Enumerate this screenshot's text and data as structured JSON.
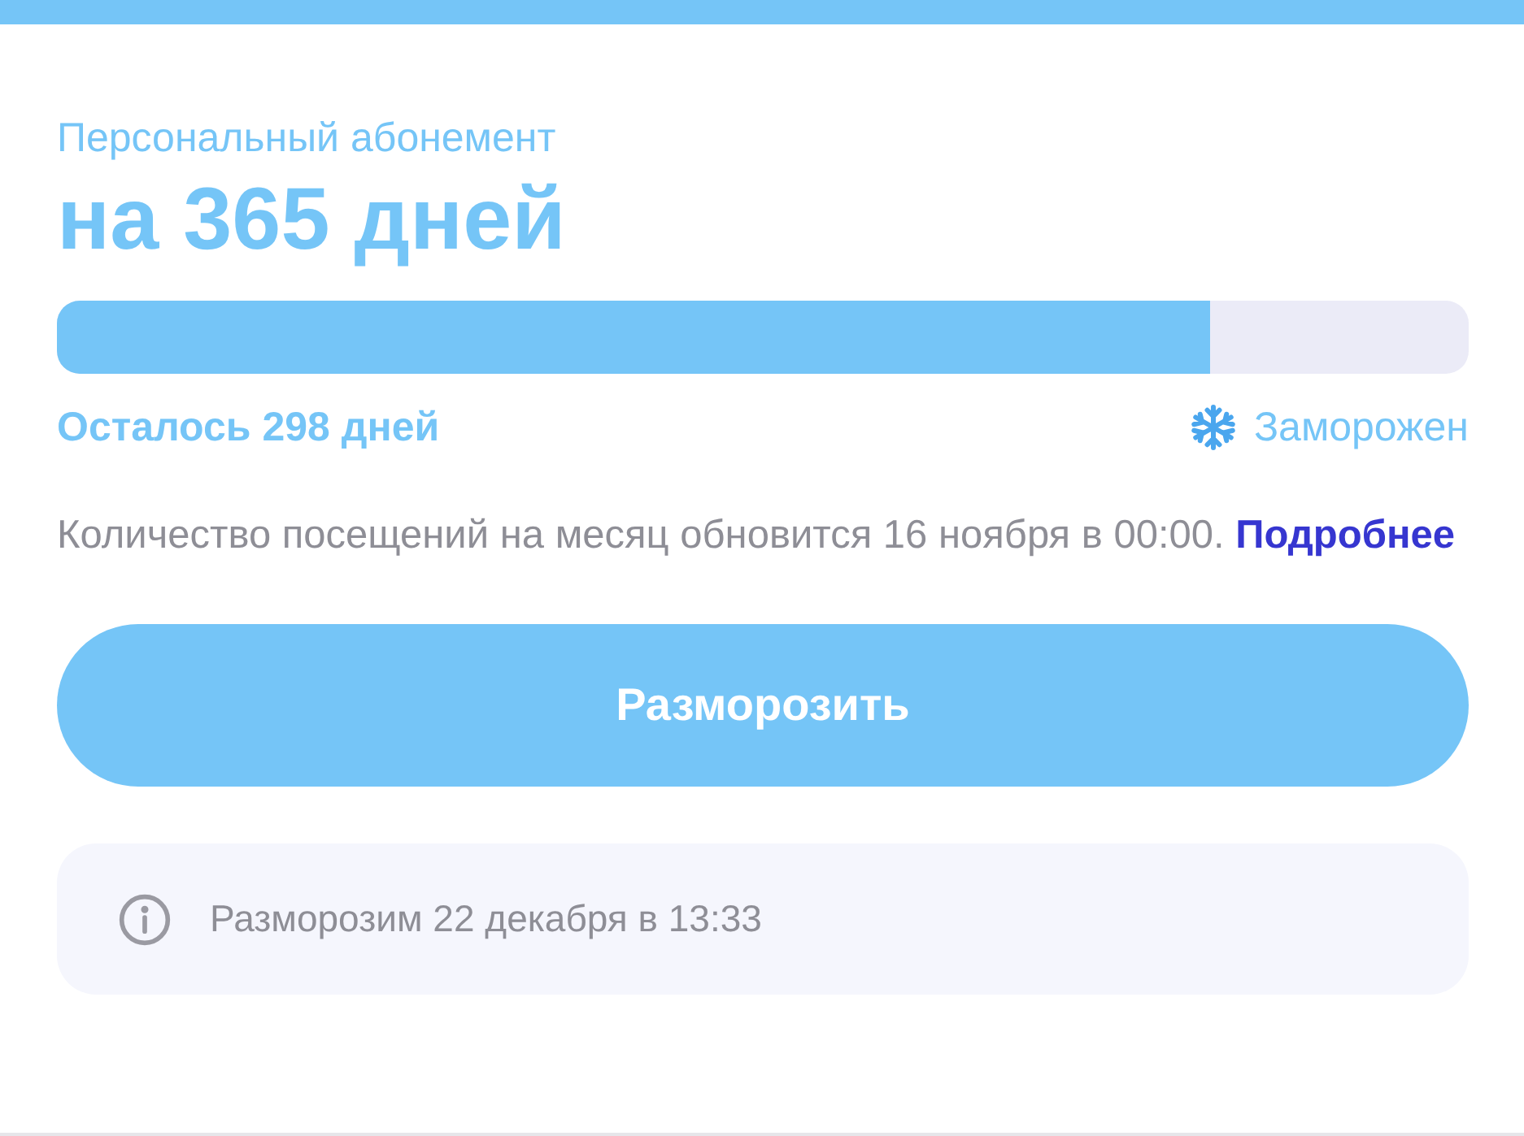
{
  "subscription": {
    "subtitle": "Персональный абонемент",
    "title": "на 365 дней",
    "level": 0.817,
    "remaining": "Осталось 298 дней",
    "status": {
      "label": "Заморожен",
      "frozen": true
    }
  },
  "notice": {
    "text": "Количество посещений на месяц обновится 16 ноября в 00:00.",
    "link": "Подробнее"
  },
  "button": "Разморозить",
  "info": "Разморозим 22 декабря в 13:33"
}
